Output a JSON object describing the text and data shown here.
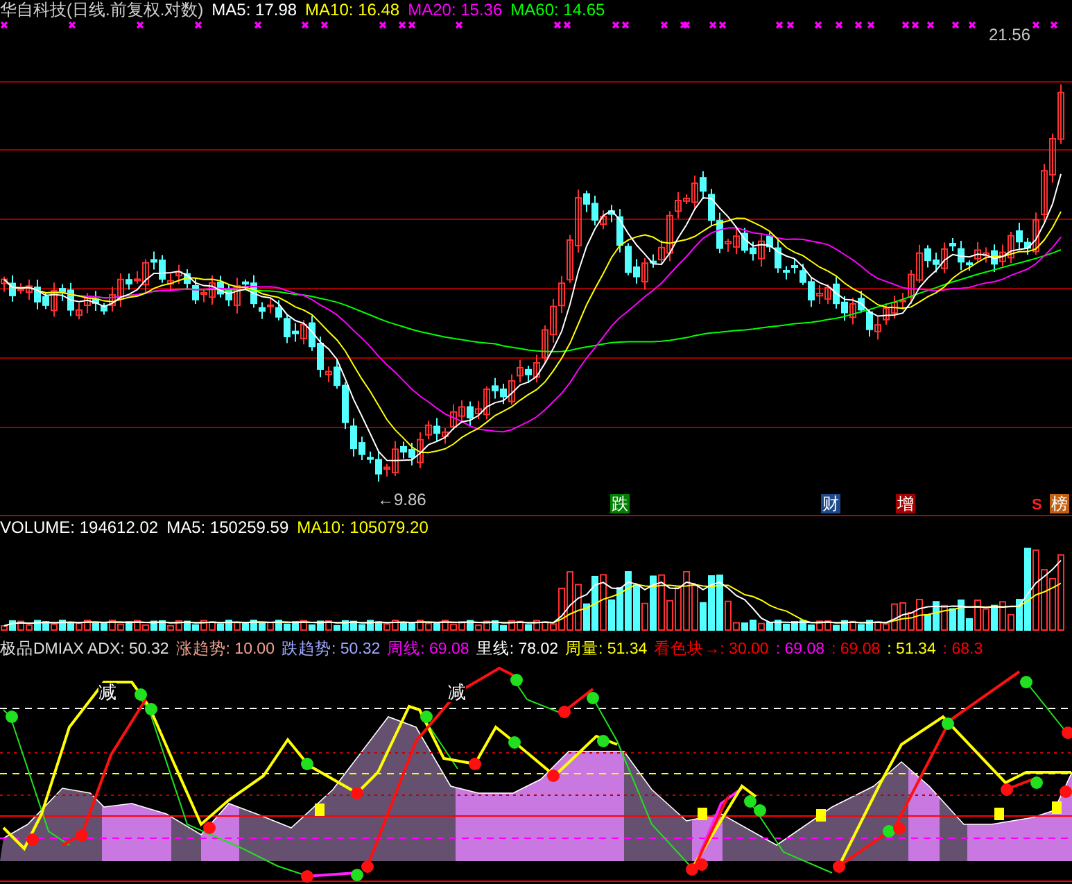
{
  "header": {
    "title": "华自科技(日线.前复权.对数)",
    "ma": [
      {
        "label": "MA5: 17.98",
        "color": "#ffffff"
      },
      {
        "label": "MA10: 16.48",
        "color": "#ffff00"
      },
      {
        "label": "MA20: 15.36",
        "color": "#ff00ff"
      },
      {
        "label": "MA60: 14.65",
        "color": "#00ff00"
      }
    ]
  },
  "price_chart": {
    "high_label": "21.56",
    "low_label": "←9.86",
    "signal": "S",
    "markers": [
      {
        "text": "跌",
        "color": "#008000"
      },
      {
        "text": "财",
        "color": "#1f4a8a"
      },
      {
        "text": "增",
        "color": "#a00000"
      },
      {
        "text": "榜",
        "color": "#c06010"
      }
    ]
  },
  "volume": {
    "items": [
      {
        "label": "VOLUME: 194612.02",
        "color": "#ffffff"
      },
      {
        "label": "MA5: 150259.59",
        "color": "#ffffff"
      },
      {
        "label": "MA10: 105079.20",
        "color": "#ffff00"
      }
    ]
  },
  "indicator": {
    "items": [
      {
        "label": "极品DMIAX ADX: 50.32",
        "color": "#e0e0e0"
      },
      {
        "label": "涨趋势: 10.00",
        "color": "#f0a090"
      },
      {
        "label": "跌趋势: 50.32",
        "color": "#a0a8ff"
      },
      {
        "label": "周线: 69.08",
        "color": "#ff00ff"
      },
      {
        "label": "里线: 78.02",
        "color": "#ffffff"
      },
      {
        "label": "周量: 51.34",
        "color": "#ffff00"
      },
      {
        "label": "看色块→: 30.00",
        "color": "#ff0000"
      },
      {
        "label": ": 69.08",
        "color": "#ff00ff"
      },
      {
        "label": ": 69.08",
        "color": "#ff0000"
      },
      {
        "label": ": 51.34",
        "color": "#ffff00"
      },
      {
        "label": ": 68.3",
        "color": "#ff0000"
      }
    ],
    "signs": [
      "减",
      "减"
    ]
  }
}
